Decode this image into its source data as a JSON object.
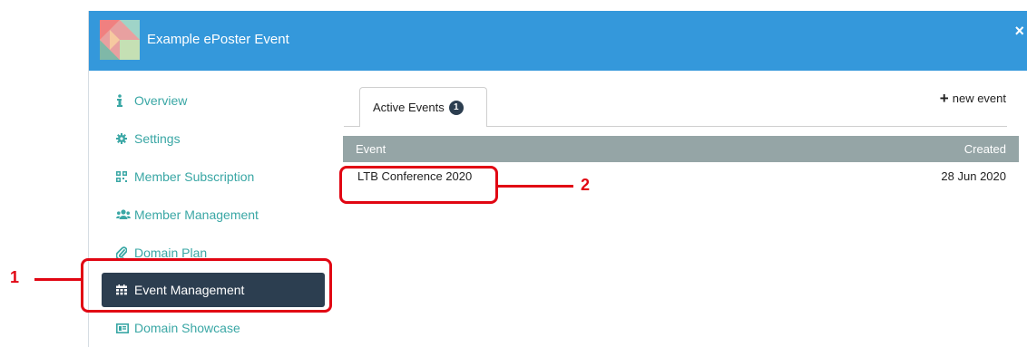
{
  "header": {
    "title": "Example ePoster Event",
    "close_label": "×"
  },
  "sidebar": {
    "items": [
      {
        "label": "Overview",
        "icon": "info-icon"
      },
      {
        "label": "Settings",
        "icon": "gear-icon"
      },
      {
        "label": "Member Subscription",
        "icon": "qrcode-icon"
      },
      {
        "label": "Member Management",
        "icon": "users-icon"
      },
      {
        "label": "Domain Plan",
        "icon": "paperclip-icon"
      },
      {
        "label": "Event Management",
        "icon": "calendar-icon",
        "active": true
      },
      {
        "label": "Domain Showcase",
        "icon": "slideshow-icon"
      }
    ]
  },
  "tabs": [
    {
      "label": "Active Events",
      "badge": "1",
      "active": true
    }
  ],
  "actions": {
    "new_event_label": "new event"
  },
  "table": {
    "columns": [
      "Event",
      "Created"
    ],
    "rows": [
      {
        "event": "LTB Conference 2020",
        "created": "28 Jun 2020"
      }
    ]
  },
  "annotations": [
    {
      "number": "1"
    },
    {
      "number": "2"
    }
  ],
  "colors": {
    "header": "#3498db",
    "active_item": "#2c3e50",
    "sidebar_text": "#3aa7a5",
    "table_header": "#95a5a6",
    "annotation": "#e10613"
  }
}
